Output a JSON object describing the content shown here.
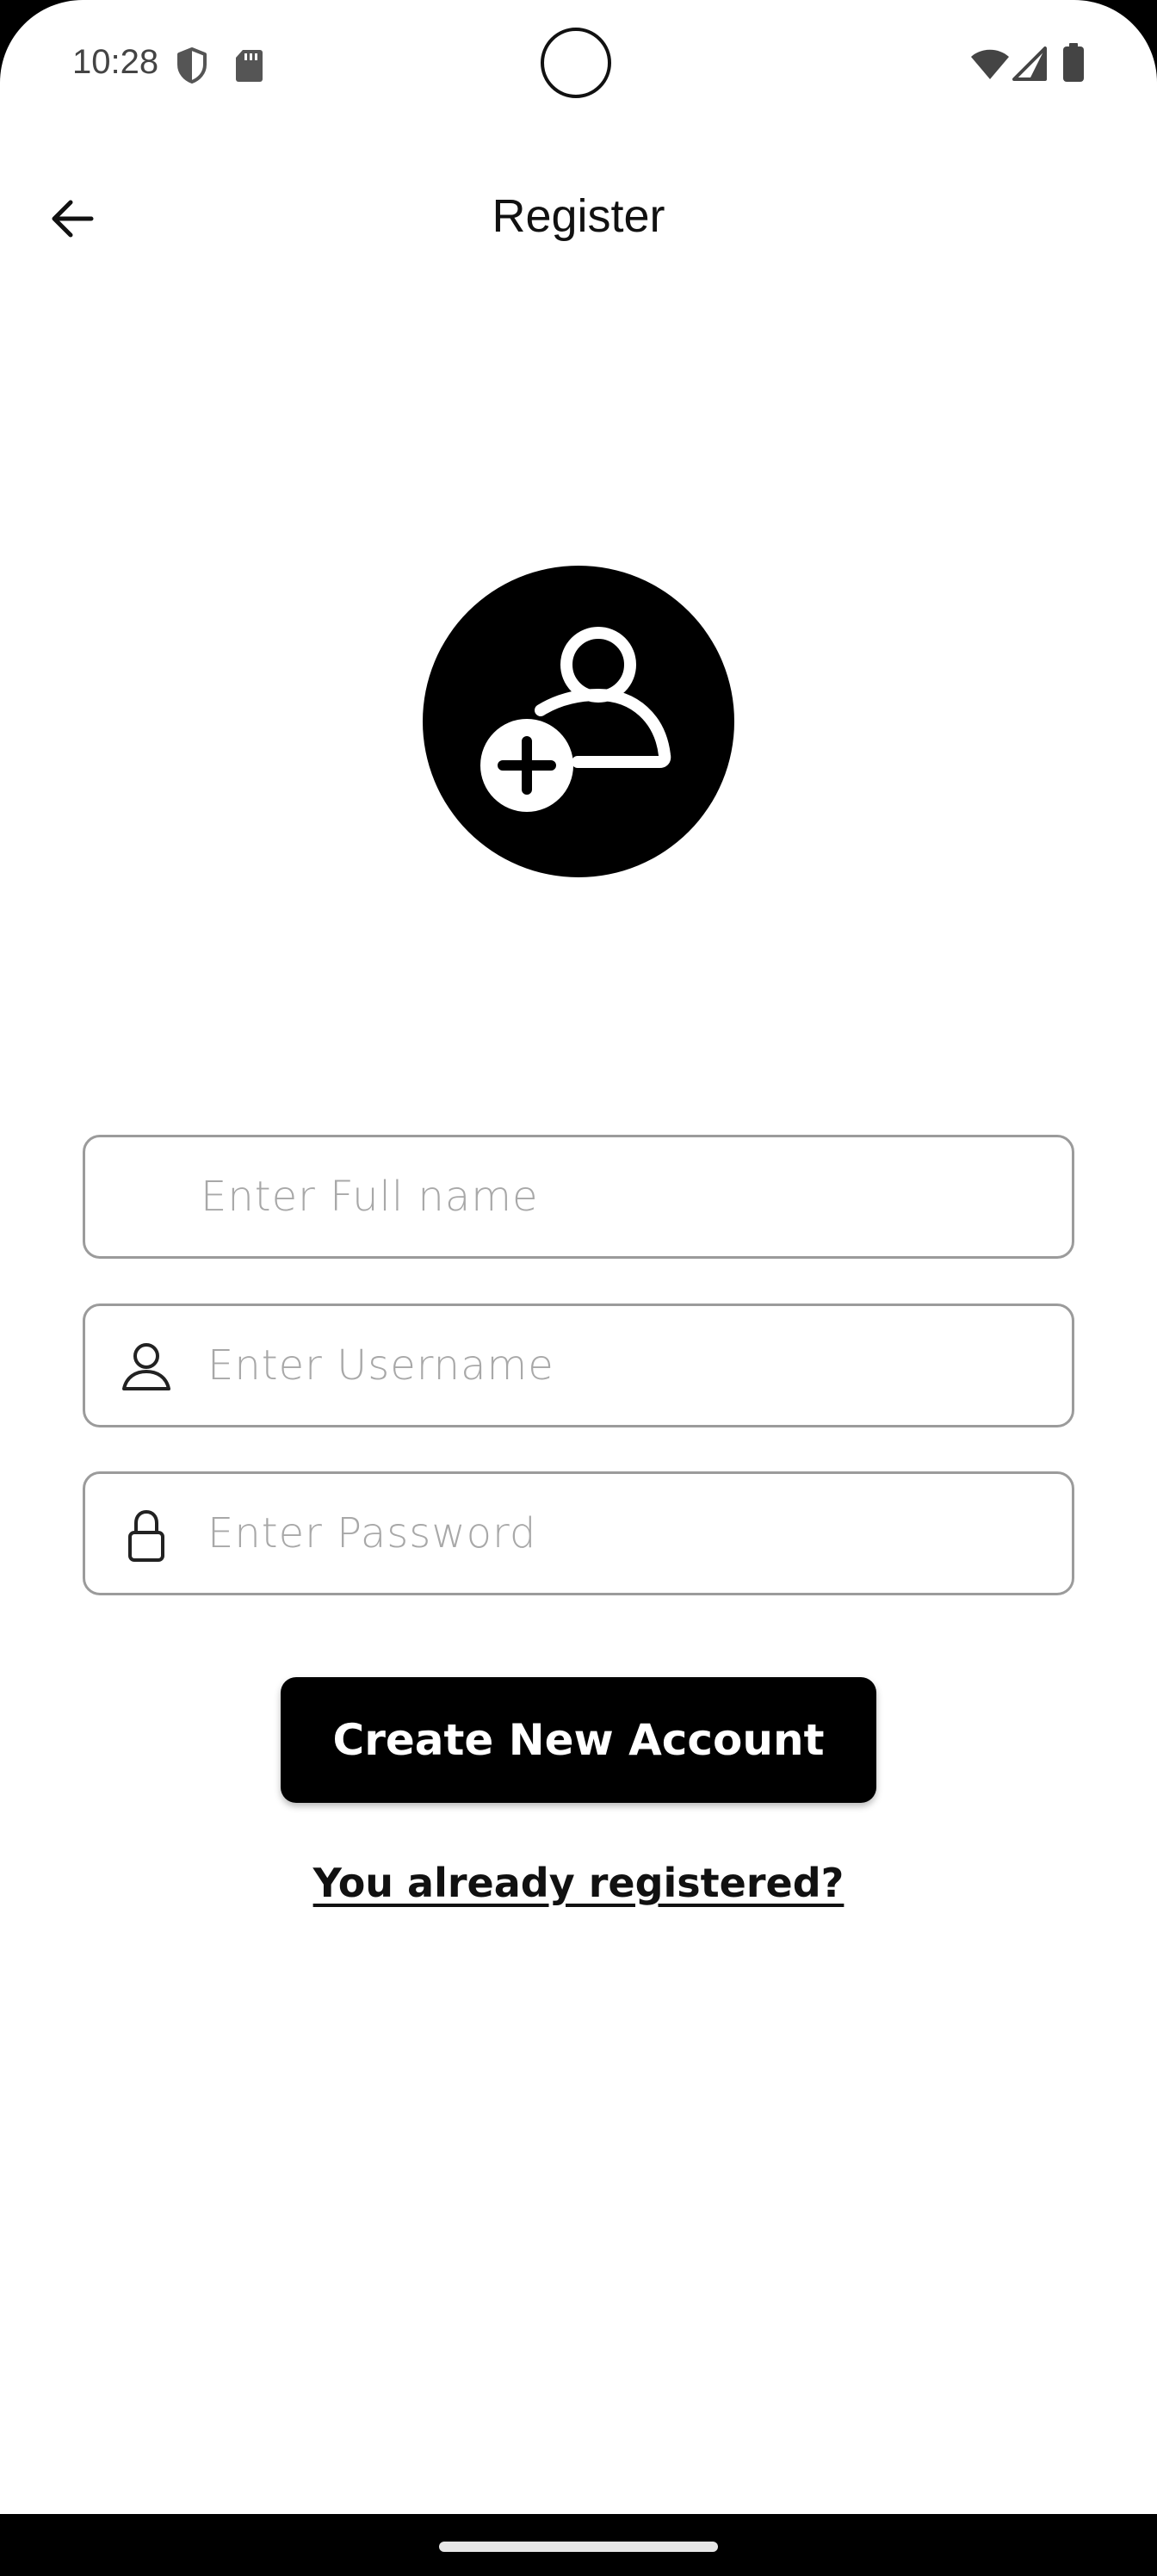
{
  "status_bar": {
    "time": "10:28",
    "left_icons": [
      "shield-icon",
      "sd-card-icon"
    ],
    "right_icons": [
      "wifi-icon",
      "signal-icon",
      "battery-icon"
    ]
  },
  "app_bar": {
    "title": "Register",
    "back_icon": "arrow-left-icon"
  },
  "avatar": {
    "icon": "add-user-icon"
  },
  "form": {
    "full_name": {
      "placeholder": "Enter Full name",
      "value": ""
    },
    "username": {
      "placeholder": "Enter Username",
      "value": "",
      "icon": "user-icon"
    },
    "password": {
      "placeholder": "Enter Password",
      "value": "",
      "icon": "lock-icon"
    }
  },
  "actions": {
    "create_label": "Create New Account",
    "login_link": "You already registered?"
  },
  "colors": {
    "primary": "#000000",
    "background": "#ffffff",
    "field_border": "#9b9b9b",
    "placeholder": "#a8a8a8"
  }
}
